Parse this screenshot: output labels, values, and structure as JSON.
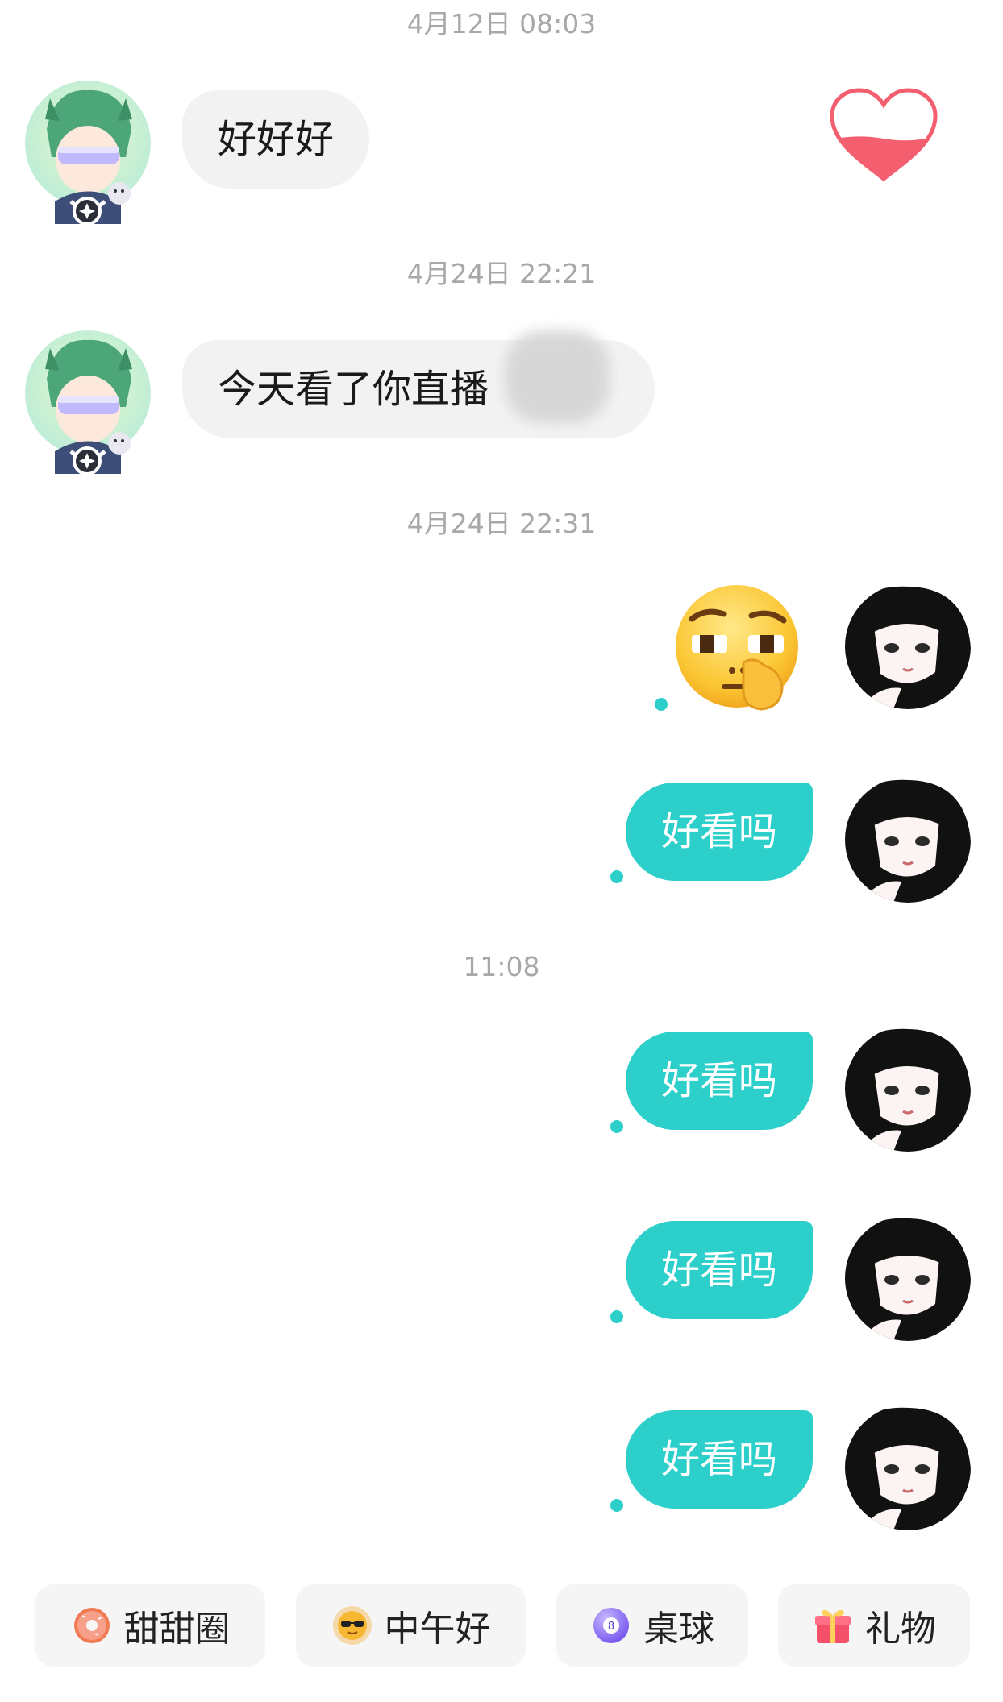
{
  "messages": [
    {
      "timestamp": "4月12日 08:03",
      "direction": "in",
      "text": "好好好"
    },
    {
      "timestamp": "4月24日 22:21",
      "direction": "in",
      "text": "今天看了你直播"
    },
    {
      "timestamp": "4月24日 22:31",
      "direction": "out",
      "type": "emoji",
      "emoji": "shush-eyes-emoji"
    },
    {
      "direction": "out",
      "text": "好看吗"
    },
    {
      "timestamp": "11:08",
      "direction": "out",
      "text": "好看吗"
    },
    {
      "direction": "out",
      "text": "好看吗"
    },
    {
      "direction": "out",
      "text": "好看吗"
    }
  ],
  "heart_widget": {
    "icon": "heart-fill-icon",
    "fill_fraction": 0.3,
    "color": "#f45f6f"
  },
  "quick_replies": [
    {
      "label": "甜甜圈",
      "icon": "donut-icon"
    },
    {
      "label": "中午好",
      "icon": "sun-sunglasses-icon"
    },
    {
      "label": "桌球",
      "icon": "billiard-ball-icon"
    },
    {
      "label": "礼物",
      "icon": "gift-icon"
    }
  ],
  "colors": {
    "outgoing_bubble": "#2ccfca",
    "incoming_bubble": "#f2f2f2",
    "timestamp": "#a8a8a8"
  }
}
